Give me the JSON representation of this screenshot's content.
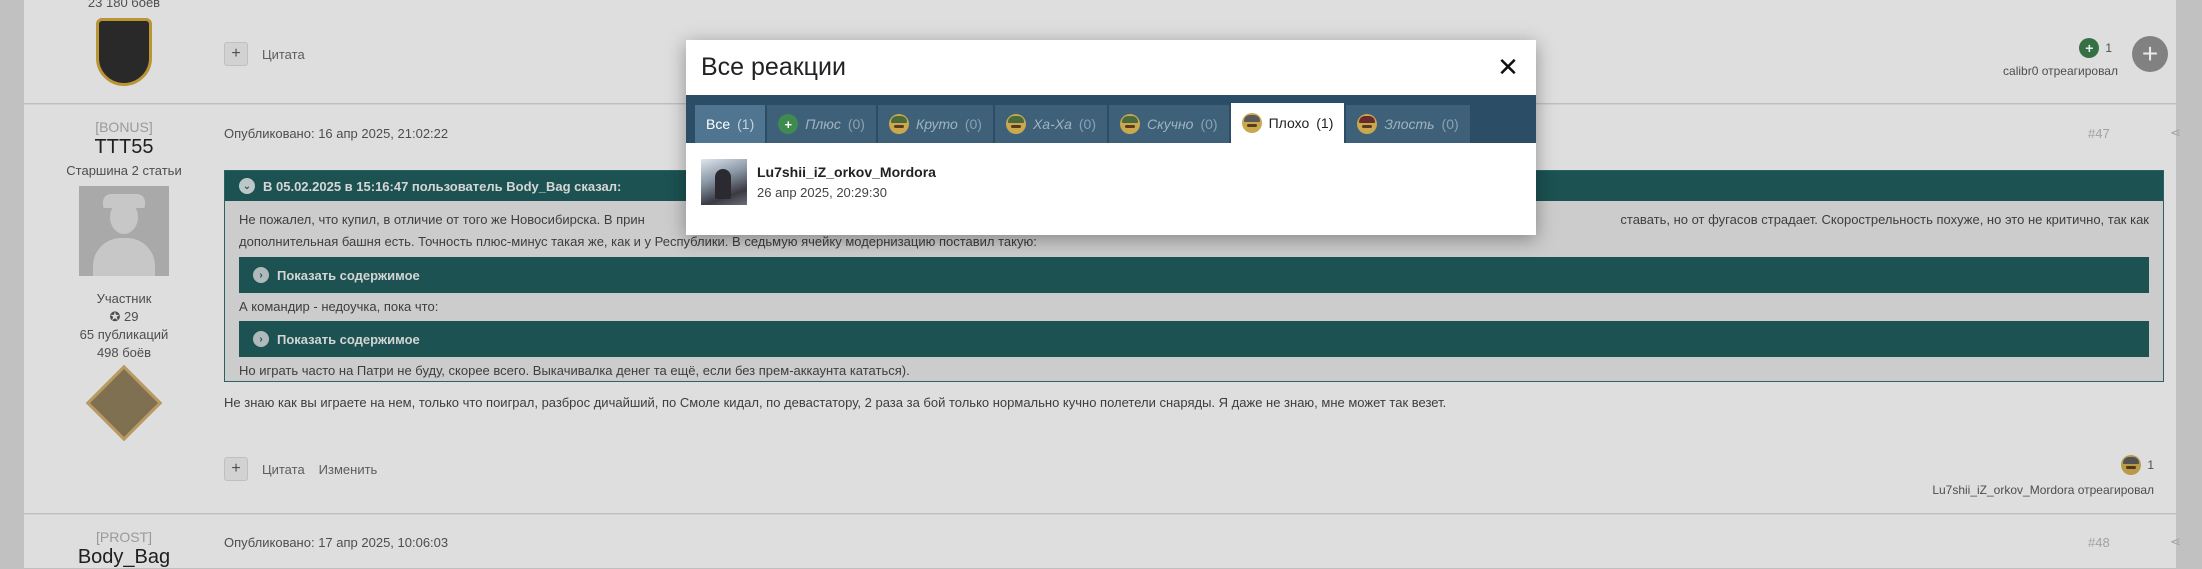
{
  "modal": {
    "title": "Все реакции",
    "tabs": [
      {
        "label": "Все",
        "count": "(1)",
        "icon": "none"
      },
      {
        "label": "Плюс",
        "count": "(0)",
        "icon": "plus"
      },
      {
        "label": "Круто",
        "count": "(0)",
        "icon": "face"
      },
      {
        "label": "Ха-Ха",
        "count": "(0)",
        "icon": "face"
      },
      {
        "label": "Скучно",
        "count": "(0)",
        "icon": "face"
      },
      {
        "label": "Плохо",
        "count": "(1)",
        "icon": "face-bad"
      },
      {
        "label": "Злость",
        "count": "(0)",
        "icon": "face-angry"
      }
    ],
    "active_tab": "Плохо",
    "reactor": {
      "name": "Lu7shii_iZ_orkov_Mordora",
      "time": "26 апр 2025, 20:29:30"
    }
  },
  "post1": {
    "battles": "23 180 боёв",
    "quote_label": "Цитата",
    "reaction_count": "1",
    "reacted_text": "calibr0 отреагировал"
  },
  "post2": {
    "group": "[BONUS]",
    "nick": "TTT55",
    "rank": "Старшина 2 статьи",
    "role": "Участник",
    "reputation": "29",
    "publications": "65 публикаций",
    "battles": "498 боёв",
    "published": "Опубликовано: 16 апр 2025, 21:02:22",
    "post_number": "#47",
    "quote_header": "В 05.02.2025 в 15:16:47 пользователь Body_Bag сказал:",
    "quote_line1_left": "Не пожалел, что купил, в отличие от того же Новосибирска. В прин",
    "quote_line1_right": "ставать, но от фугасов страдает. Скорострельность похуже, но это не критично, так как",
    "quote_line2": "дополнительная башня есть. Точность плюс-минус такая же, как и у Республики. В седьмую ячейку модернизацию поставил такую:",
    "spoiler1": "Показать содержимое",
    "quote_line3": "А командир - недоучка, пока что:",
    "spoiler2": "Показать содержимое",
    "quote_line4": "Но играть часто на Патри не буду, скорее всего. Выкачивалка денег та ещё, если без прем-аккаунта кататься).",
    "body": "Не знаю как вы играете на нем, только что поиграл, разброс дичайший, по Смоле кидал, по девастатору, 2 раза за бой только нормально кучно полетели снаряды. Я даже не знаю, мне может так везет.",
    "quote_label": "Цитата",
    "edit_label": "Изменить",
    "reaction_count": "1",
    "reacted_text": "Lu7shii_iZ_orkov_Mordora отреагировал"
  },
  "post3": {
    "group": "[PROST]",
    "nick": "Body_Bag",
    "published": "Опубликовано: 17 апр 2025, 10:06:03",
    "post_number": "#48"
  }
}
